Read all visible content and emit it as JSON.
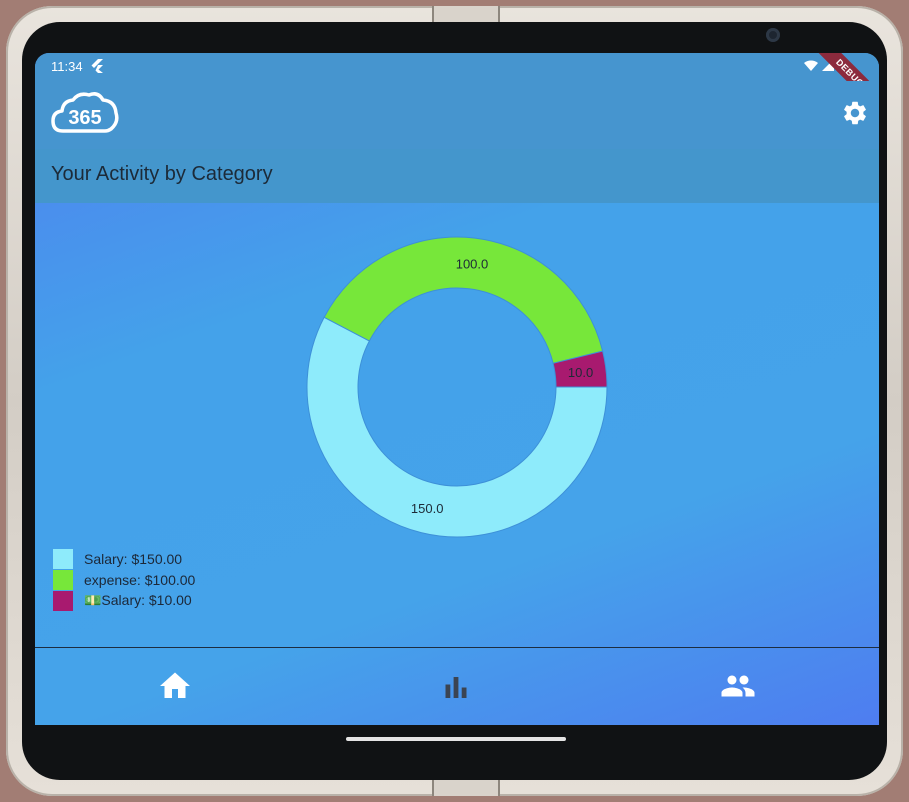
{
  "status_bar": {
    "time": "11:34",
    "debug_label": "DEBUG"
  },
  "app_bar": {
    "logo_text": "365",
    "settings_icon": "gear-icon"
  },
  "page": {
    "title": "Your Activity by Category"
  },
  "chart_data": {
    "type": "pie",
    "title": "",
    "categories": [
      "Salary",
      "expense",
      "💵Salary"
    ],
    "values": [
      150.0,
      100.0,
      10.0
    ],
    "value_labels": [
      "150.0",
      "100.0",
      "10.0"
    ],
    "colors": [
      "#8eebfb",
      "#77e73a",
      "#a81a6f"
    ],
    "donut": true,
    "legend_position": "bottom-left"
  },
  "legend": {
    "items": [
      {
        "label": "Salary: $150.00",
        "color": "#8eebfb"
      },
      {
        "label": "expense: $100.00",
        "color": "#77e73a"
      },
      {
        "label": "💵Salary: $10.00",
        "color": "#a81a6f"
      }
    ]
  },
  "bottom_nav": {
    "items": [
      {
        "icon": "home-icon",
        "active": true
      },
      {
        "icon": "bar-chart-icon",
        "active": false
      },
      {
        "icon": "people-icon",
        "active": true
      }
    ]
  },
  "colors": {
    "app_bar": "#4695cf",
    "header_strip": "#4496cc",
    "background_gradient_start": "#4f7ff0",
    "background_gradient_mid": "#44a2ea"
  }
}
